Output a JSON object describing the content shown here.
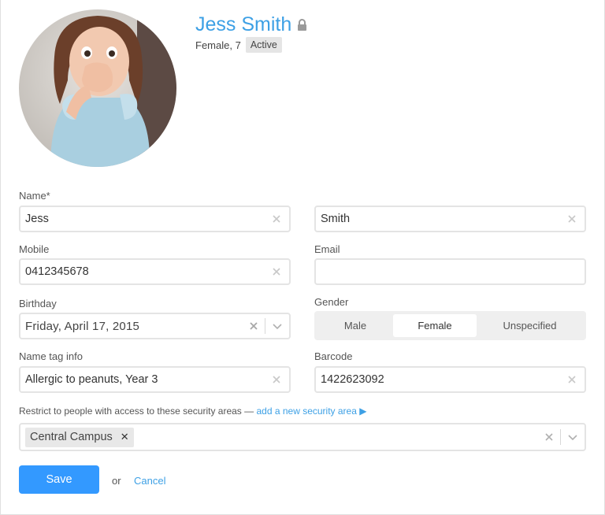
{
  "profile": {
    "name": "Jess Smith",
    "meta": "Female, 7",
    "status": "Active"
  },
  "form": {
    "name_label": "Name*",
    "first_name": "Jess",
    "last_name": "Smith",
    "mobile_label": "Mobile",
    "mobile": "0412345678",
    "email_label": "Email",
    "email": "",
    "birthday_label": "Birthday",
    "birthday": "Friday, April 17, 2015",
    "gender_label": "Gender",
    "gender_options": [
      "Male",
      "Female",
      "Unspecified"
    ],
    "gender_selected": "Female",
    "name_tag_label": "Name tag info",
    "name_tag": "Allergic to peanuts, Year 3",
    "barcode_label": "Barcode",
    "barcode": "1422623092",
    "restrict_label": "Restrict to people with access to these security areas —",
    "restrict_link": "add a new security area ▶",
    "security_areas": [
      "Central Campus"
    ]
  },
  "actions": {
    "save": "Save",
    "or": "or",
    "cancel": "Cancel"
  },
  "colors": {
    "accent": "#3da0e5",
    "primary_button": "#3399ff"
  },
  "icons": [
    "lock-icon",
    "clear-icon",
    "chevron-down-icon",
    "remove-tag-icon",
    "triangle-right-icon"
  ]
}
